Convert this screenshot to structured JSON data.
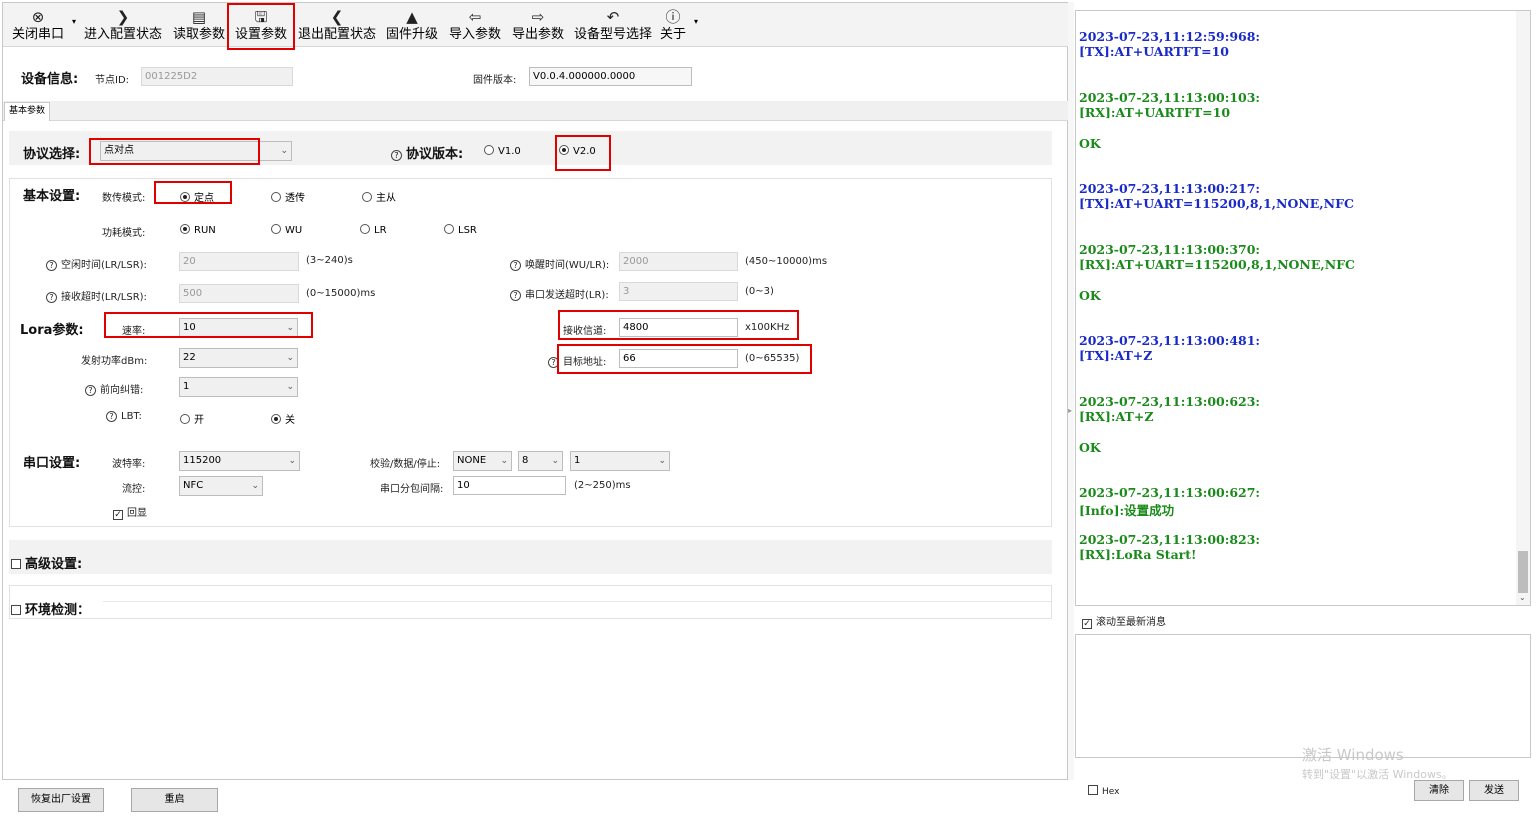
{
  "toolbar": {
    "items": [
      {
        "label": "关闭串口",
        "icon": "close-port-icon"
      },
      {
        "label": "进入配置状态",
        "icon": "chevron-right-icon"
      },
      {
        "label": "读取参数",
        "icon": "read-params-icon"
      },
      {
        "label": "设置参数",
        "icon": "save-icon"
      },
      {
        "label": "退出配置状态",
        "icon": "chevron-left-icon"
      },
      {
        "label": "固件升级",
        "icon": "rocket-icon"
      },
      {
        "label": "导入参数",
        "icon": "import-icon"
      },
      {
        "label": "导出参数",
        "icon": "export-icon"
      },
      {
        "label": "设备型号选择",
        "icon": "undo-arrow-icon"
      },
      {
        "label": "关于",
        "icon": "info-icon"
      }
    ]
  },
  "device": {
    "title": "设备信息:",
    "node_id_label": "节点ID:",
    "node_id": "001225D2",
    "fw_label": "固件版本:",
    "fw_version": "V0.0.4.000000.0000"
  },
  "tab": {
    "label": "基本参数"
  },
  "protocol": {
    "label": "协议选择:",
    "value": "点对点",
    "version_label": "协议版本:",
    "v1": "V1.0",
    "v2": "V2.0",
    "selected": "V2.0"
  },
  "basic": {
    "title": "基本设置:",
    "mode_label": "数传模式:",
    "mode_options": [
      "定点",
      "透传",
      "主从"
    ],
    "mode_selected": "定点",
    "power_label": "功耗模式:",
    "power_options": [
      "RUN",
      "WU",
      "LR",
      "LSR"
    ],
    "power_selected": "RUN",
    "idle_label": "空闲时间(LR/LSR):",
    "idle_value": "20",
    "idle_range": "(3~240)s",
    "wake_label": "唤醒时间(WU/LR):",
    "wake_value": "2000",
    "wake_range": "(450~10000)ms",
    "rx_timeout_label": "接收超时(LR/LSR):",
    "rx_timeout_value": "500",
    "rx_timeout_range": "(0~15000)ms",
    "uart_timeout_label": "串口发送超时(LR):",
    "uart_timeout_value": "3",
    "uart_timeout_range": "(0~3)"
  },
  "lora": {
    "title": "Lora参数:",
    "rate_label": "速率:",
    "rate_value": "10",
    "power_label": "发射功率dBm:",
    "power_value": "22",
    "fec_label": "前向纠错:",
    "fec_value": "1",
    "lbt_label": "LBT:",
    "lbt_on": "开",
    "lbt_off": "关",
    "lbt_selected": "关",
    "channel_label": "接收信道:",
    "channel_value": "4800",
    "channel_unit": "x100KHz",
    "addr_label": "目标地址:",
    "addr_value": "66",
    "addr_range": "(0~65535)"
  },
  "serial": {
    "title": "串口设置:",
    "baud_label": "波特率:",
    "baud_value": "115200",
    "parity_label": "校验/数据/停止:",
    "parity_value": "NONE",
    "data_value": "8",
    "stop_value": "1",
    "flow_label": "流控:",
    "flow_value": "NFC",
    "gap_label": "串口分包间隔:",
    "gap_value": "10",
    "gap_range": "(2~250)ms",
    "echo_label": "回显"
  },
  "advanced": {
    "label": "高级设置:"
  },
  "env": {
    "label": "环境检测："
  },
  "bottom": {
    "factory_reset": "恢复出厂设置",
    "restart": "重启"
  },
  "log": {
    "entries": [
      {
        "ts": "2023-07-23,11:12:59:968:",
        "msg": "[TX]:AT+UARTFT=10",
        "tx": true
      },
      {
        "ts": "2023-07-23,11:13:00:103:",
        "msg": "[RX]:AT+UARTFT=10",
        "ok": "OK"
      },
      {
        "ts": "2023-07-23,11:13:00:217:",
        "msg": "[TX]:AT+UART=115200,8,1,NONE,NFC",
        "tx": true
      },
      {
        "ts": "2023-07-23,11:13:00:370:",
        "msg": "[RX]:AT+UART=115200,8,1,NONE,NFC",
        "ok": "OK"
      },
      {
        "ts": "2023-07-23,11:13:00:481:",
        "msg": "[TX]:AT+Z",
        "tx": true
      },
      {
        "ts": "2023-07-23,11:13:00:623:",
        "msg": "[RX]:AT+Z",
        "ok": "OK"
      },
      {
        "ts": "2023-07-23,11:13:00:627:",
        "msg": "[Info]:设置成功"
      },
      {
        "ts": "2023-07-23,11:13:00:823:",
        "msg": "[RX]:LoRa Start!"
      }
    ],
    "autoscroll_label": "滚动至最新消息"
  },
  "send": {
    "hex_label": "Hex",
    "clear": "清除",
    "send": "发送"
  },
  "watermark": {
    "line1": "激活 Windows",
    "line2": "转到\"设置\"以激活 Windows。"
  },
  "colors": {
    "highlight": "#e00000",
    "log_green": "#1a8a1a",
    "log_blue": "#1a2ac8"
  }
}
